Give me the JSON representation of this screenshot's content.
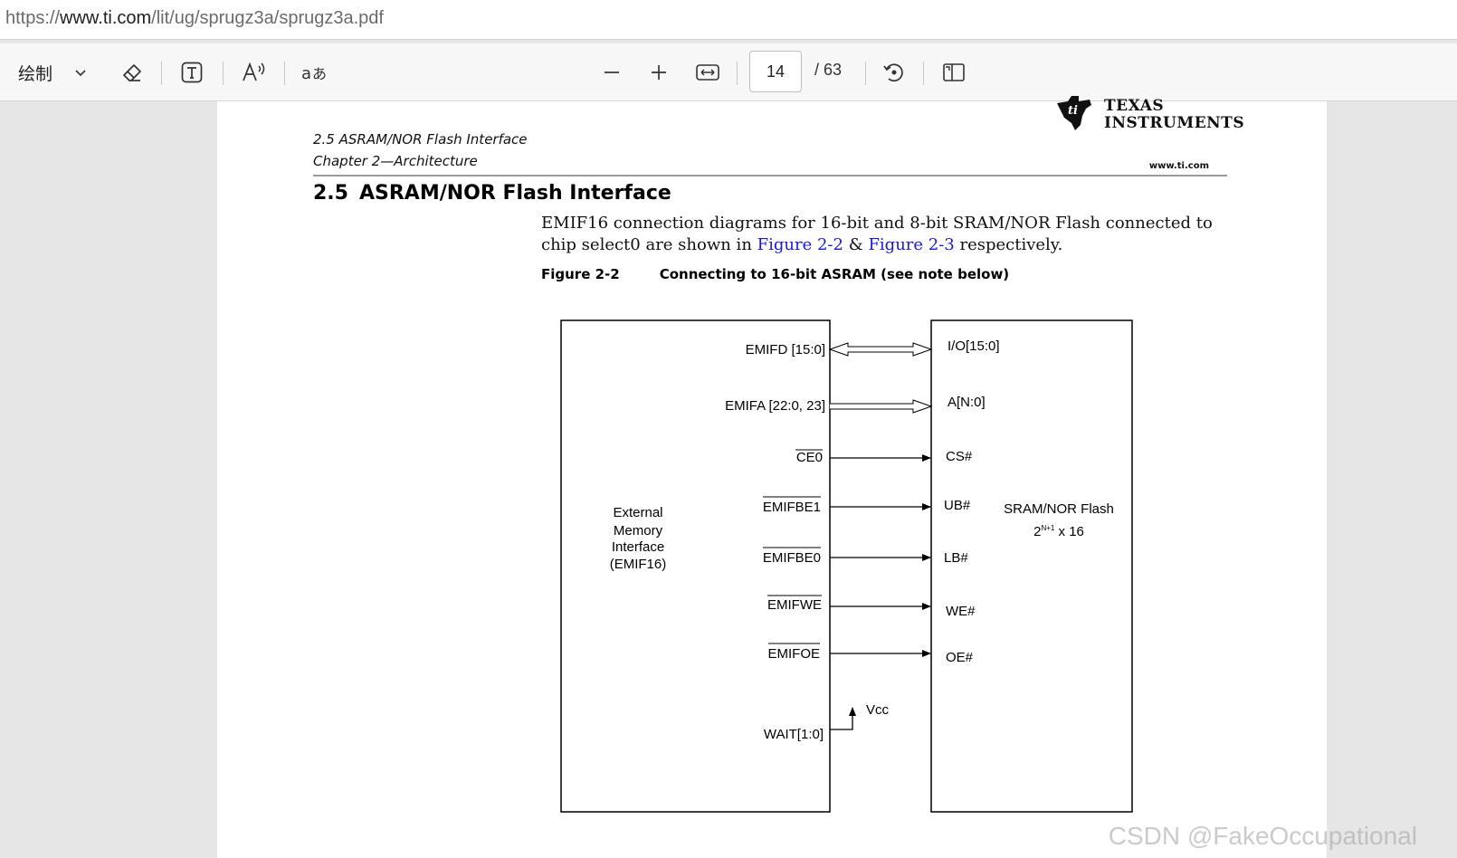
{
  "address_bar": {
    "scheme": "https://",
    "host": "www.ti.com",
    "path": "/lit/ug/sprugz3a/sprugz3a.pdf"
  },
  "toolbar": {
    "draw_label": "绘制",
    "current_page": "14",
    "total_pages": "/ 63",
    "icons": [
      "chevron-down-icon",
      "eraser-icon",
      "text-box-icon",
      "read-aloud-icon",
      "translate-icon",
      "zoom-out-icon",
      "zoom-in-icon",
      "fit-width-icon",
      "rotate-icon",
      "page-view-icon"
    ]
  },
  "document": {
    "header": {
      "section": "2.5   ASRAM/NOR Flash Interface",
      "chapter": "Chapter 2—Architecture",
      "website": "www.ti.com",
      "logo_line1": "TEXAS",
      "logo_line2": "INSTRUMENTS"
    },
    "section_number": "2.5",
    "section_title": "ASRAM/NOR Flash Interface",
    "paragraph": {
      "part1": "EMIF16 connection diagrams for 16-bit and 8-bit SRAM/NOR Flash connected to chip select0 are shown in ",
      "link1": "Figure 2-2",
      "part2": " & ",
      "link2": "Figure 2-3",
      "part3": " respectively."
    },
    "figure_label": "Figure 2-2",
    "figure_title": "Connecting to 16-bit ASRAM (see note below)"
  },
  "diagram": {
    "left_block": [
      "External",
      "Memory",
      "Interface",
      "(EMIF16)"
    ],
    "right_block_name": "SRAM/NOR Flash",
    "right_block_size_base": "2",
    "right_block_size_exp": "N+1",
    "right_block_size_rest": " x 16",
    "signals": [
      {
        "left": "EMIFD [15:0]",
        "right": "I/O[15:0]"
      },
      {
        "left": "EMIFA [22:0, 23]",
        "right": "A[N:0]"
      },
      {
        "left": "CE0",
        "right": "CS#"
      },
      {
        "left": "EMIFBE1",
        "right": "UB#"
      },
      {
        "left": "EMIFBE0",
        "right": "LB#"
      },
      {
        "left": "EMIFWE",
        "right": "WE#"
      },
      {
        "left": "EMIFOE",
        "right": "OE#"
      }
    ],
    "wait_label": "WAIT[1:0]",
    "vcc_label": "Vcc"
  },
  "watermark": "CSDN @FakeOccupational"
}
